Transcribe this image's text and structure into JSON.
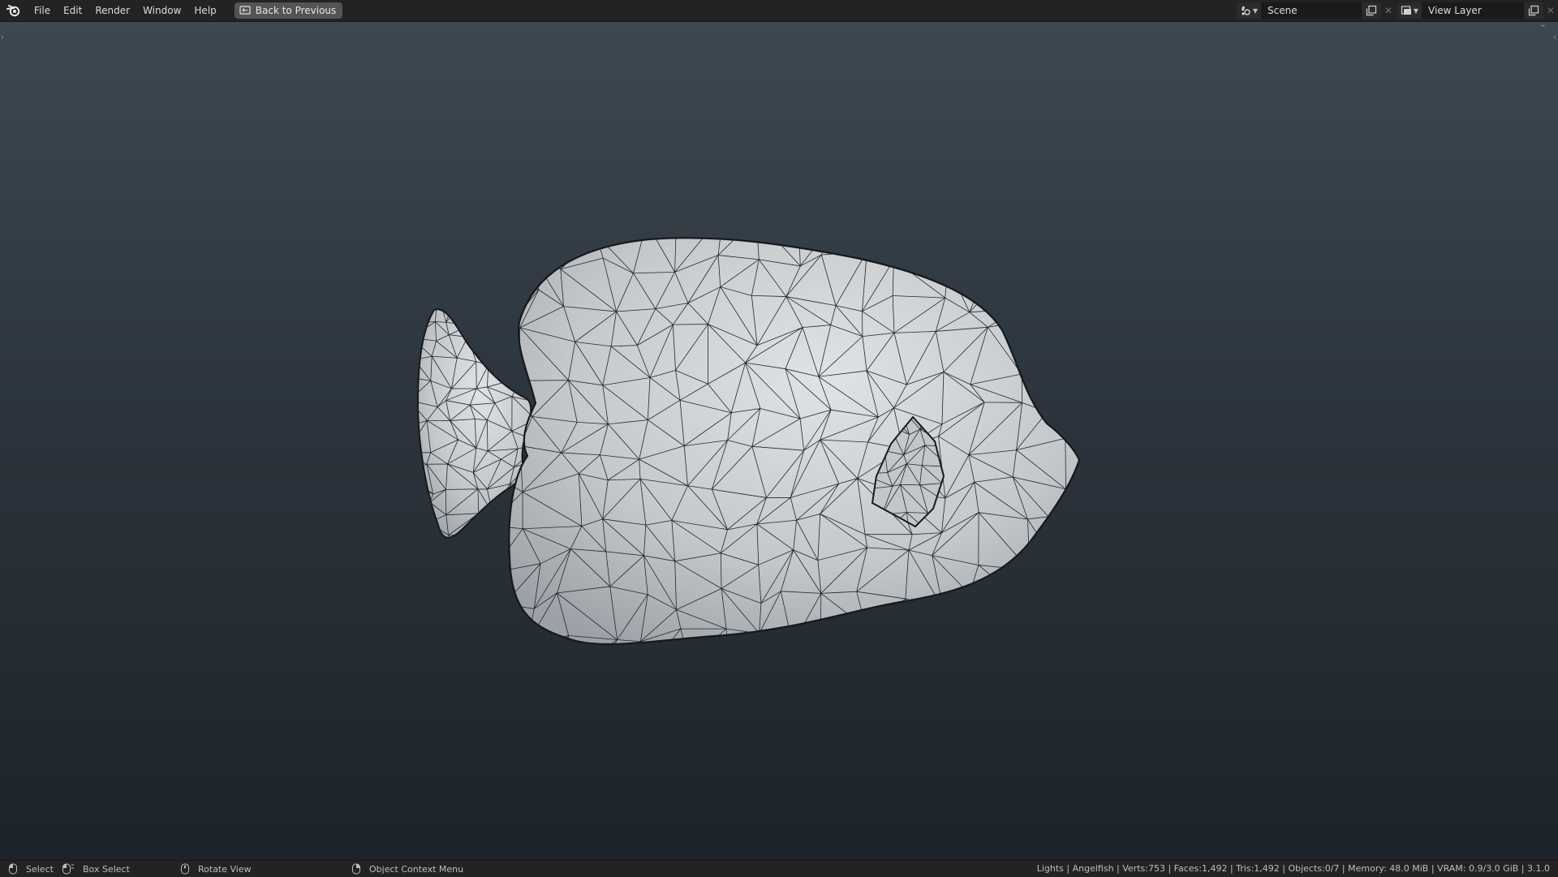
{
  "menubar": {
    "items": [
      "File",
      "Edit",
      "Render",
      "Window",
      "Help"
    ],
    "back_button": "Back to Previous"
  },
  "scene_selector": {
    "value": "Scene",
    "icon": "scene-icon"
  },
  "view_layer_selector": {
    "value": "View Layer",
    "icon": "view-layer-icon"
  },
  "statusbar": {
    "hints": [
      {
        "label": "Select",
        "icon": "mouse-left-icon"
      },
      {
        "label": "Box Select",
        "icon": "mouse-drag-icon"
      },
      {
        "label": "Rotate View",
        "icon": "mouse-middle-icon"
      },
      {
        "label": "Object Context Menu",
        "icon": "mouse-right-icon"
      }
    ],
    "stats": "Lights | Angelfish | Verts:753 | Faces:1,492 | Tris:1,492 | Objects:0/7 | Memory: 48.0 MiB | VRAM: 0.9/3.0 GiB | 3.1.0"
  },
  "colors": {
    "topbar": "#232323",
    "viewport_top": "#3d4850",
    "viewport_bottom": "#1d232b",
    "mesh_fill": "#c9cdd0",
    "wire": "#1b1f22"
  }
}
